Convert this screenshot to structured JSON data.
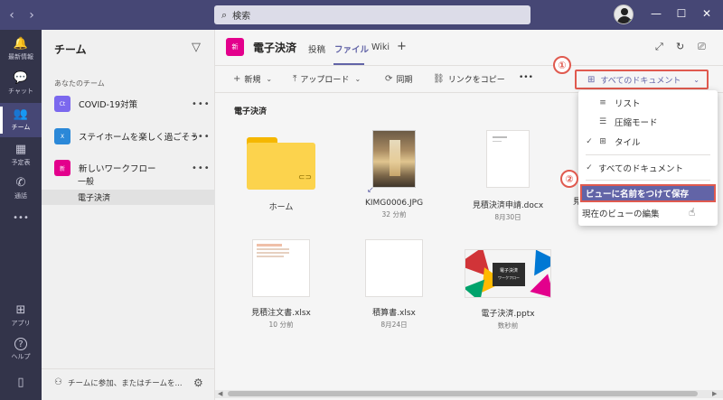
{
  "titlebar": {
    "back_icon": "chevron-left-icon",
    "forward_icon": "chevron-right-icon",
    "search_placeholder": "検索",
    "minimize": "—",
    "maximize": "☐",
    "close": "✕"
  },
  "rail": {
    "items": [
      {
        "label": "最新情報",
        "icon": "bell-icon",
        "glyph": "🔔"
      },
      {
        "label": "チャット",
        "icon": "chat-icon",
        "glyph": "💬"
      },
      {
        "label": "チーム",
        "icon": "teams-icon",
        "glyph": "👥"
      },
      {
        "label": "予定表",
        "icon": "calendar-icon",
        "glyph": "▦"
      },
      {
        "label": "通話",
        "icon": "phone-icon",
        "glyph": "✆"
      },
      {
        "label": "",
        "icon": "more-icon",
        "glyph": "•••"
      },
      {
        "label": "アプリ",
        "icon": "apps-icon",
        "glyph": "⊞"
      },
      {
        "label": "ヘルプ",
        "icon": "help-icon",
        "glyph": "?"
      },
      {
        "label": "",
        "icon": "mobile-icon",
        "glyph": "▯"
      }
    ]
  },
  "panel": {
    "title": "チーム",
    "section_label": "あなたのチーム",
    "teams": [
      {
        "abbr": "Ct",
        "name": "COVID-19対策",
        "color": "#7b68ee"
      },
      {
        "abbr": "X",
        "name": "ステイホームを楽しく過ごそう",
        "color": "#2b88d8"
      },
      {
        "abbr": "新",
        "name": "新しいワークフロー",
        "color": "#e3008c"
      }
    ],
    "channels": [
      "一般",
      "電子決済"
    ],
    "more": "•••",
    "footer_text": "チームに参加、またはチームを..."
  },
  "header": {
    "channel_abbr": "新",
    "channel_name": "電子決済",
    "tabs": [
      "投稿",
      "ファイル",
      "Wiki"
    ],
    "add_tab": "+"
  },
  "toolbar": {
    "new": "新規",
    "upload": "アップロード",
    "sync": "同期",
    "copy_link": "リンクをコピー",
    "more": "•••",
    "view_label": "すべてのドキュメント"
  },
  "callouts": [
    "①",
    "②"
  ],
  "content": {
    "folder_title": "電子決済",
    "files": [
      {
        "name": "ホーム",
        "meta": ""
      },
      {
        "name": "KIMG0006.JPG",
        "meta": "32 分前"
      },
      {
        "name": "見積決済申請.docx",
        "meta": "8月30日"
      },
      {
        "name": "見",
        "meta": ""
      },
      {
        "name": "見積注文書.xlsx",
        "meta": "10 分前"
      },
      {
        "name": "積算書.xlsx",
        "meta": "8月24日"
      },
      {
        "name": "電子決済.pptx",
        "meta": "数秒前"
      }
    ],
    "pptx_title": "電子決済",
    "pptx_subtitle": "ワークフロー"
  },
  "menu": {
    "items": [
      {
        "label": "リスト",
        "icon": "list-icon",
        "glyph": "≡",
        "checked": false
      },
      {
        "label": "圧縮モード",
        "icon": "compact-icon",
        "glyph": "☰",
        "checked": false
      },
      {
        "label": "タイル",
        "icon": "tiles-icon",
        "glyph": "⊞",
        "checked": true
      },
      {
        "label": "すべてのドキュメント",
        "icon": "",
        "glyph": "",
        "checked": true
      },
      {
        "label": "ビューに名前をつけて保存",
        "icon": "",
        "glyph": "",
        "checked": false
      },
      {
        "label": "現在のビューの編集",
        "icon": "",
        "glyph": "",
        "checked": false
      }
    ]
  },
  "colors": {
    "accent": "#6264a7",
    "titlebar": "#464775",
    "rail": "#33344a",
    "annotation": "#e05a4f"
  }
}
